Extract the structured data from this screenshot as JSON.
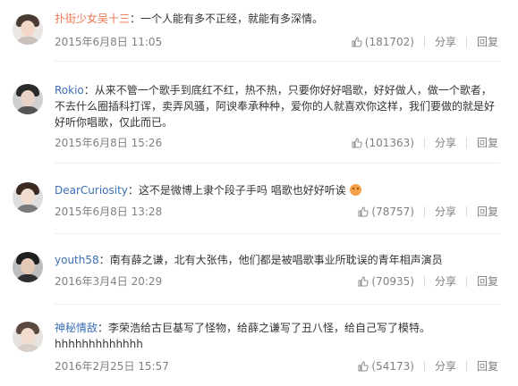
{
  "comments": [
    {
      "user": "扑街少女吴十三",
      "text": "一个人能有多不正经，就能有多深情。",
      "time": "2015年6月8日 11:05",
      "likes": "(181702)",
      "share": "分享",
      "reply": "回复"
    },
    {
      "user": "Rokio",
      "text": "从来不管一个歌手到底红不红，热不热，只要你好好唱歌，好好做人，做一个歌者，不去什么圈插科打诨，卖弄风骚，阿谀奉承种种，爱你的人就喜欢你这样，我们要做的就是好好听你唱歌，仅此而已。",
      "time": "2015年6月8日 15:26",
      "likes": "(101363)",
      "share": "分享",
      "reply": "回复"
    },
    {
      "user": "DearCuriosity",
      "text": "这不是微博上隶个段子手吗 唱歌也好好听诶",
      "emoji": "smile-emoji",
      "time": "2015年6月8日 13:28",
      "likes": "(78757)",
      "share": "分享",
      "reply": "回复"
    },
    {
      "user": "youth58",
      "text": "南有薛之谦，北有大张伟，他们都是被唱歌事业所耽误的青年相声演员",
      "time": "2016年3月4日 20:29",
      "likes": "(70935)",
      "share": "分享",
      "reply": "回复"
    },
    {
      "user": "神秘情敌",
      "text": "李荣浩给古巨基写了怪物，给薛之谦写了丑八怪，给自己写了模特。hhhhhhhhhhhhh",
      "time": "2016年2月25日 15:57",
      "likes": "(54173)",
      "share": "分享",
      "reply": "回复"
    }
  ],
  "colors": {
    "username_orange": "#eb7350",
    "username_blue": "#3c6eb4",
    "meta_gray": "#808080"
  },
  "icons": {
    "like": "thumbs-up-icon"
  }
}
